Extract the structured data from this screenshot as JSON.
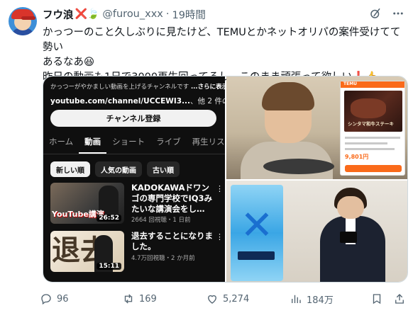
{
  "author": {
    "display_name": "フウ浪",
    "handle": "@furou_xxx",
    "separator": "·",
    "time": "19時間",
    "emoji": "❌🍃"
  },
  "tweet": {
    "line1": "かっつーのこと久しぶりに見たけど、TEMUとかネットオリパの案件受けてて勢い",
    "line2": "あるなあ😆",
    "line3": "昨日の動画も1日で3000再生回ってるし、このまま頑張って欲しい❗️👍"
  },
  "youtube": {
    "description": "かっつーがやかましい動画を上げるチャンネルです",
    "description_more": "...さらに表示",
    "link": "youtube.com/channel/UCCEWI3...",
    "link_more": "、他 2 件のリンク",
    "subscribe_label": "チャンネル登録",
    "tabs": [
      "ホーム",
      "動画",
      "ショート",
      "ライブ",
      "再生リス"
    ],
    "chips": [
      "新しい順",
      "人気の動画",
      "古い順"
    ],
    "videos": [
      {
        "title": "KADOKAWAドワンゴの専門学校でIQ3みたいな講演会をし…",
        "meta": "2664 回視聴・1 日前",
        "duration": "26:52",
        "banner": "YouTube講演"
      },
      {
        "title": "退去することになりました。",
        "meta": "4.7万回視聴・2 か月前",
        "duration": "15:11",
        "banner": "退去"
      }
    ]
  },
  "product_card": {
    "store": "TEMU",
    "title": "シンタマ和牛ステーキ",
    "price": "9,801円"
  },
  "actions": {
    "replies": "96",
    "retweets": "169",
    "likes": "5,274",
    "views": "184万"
  },
  "colors": {
    "text": "#0f1419",
    "muted": "#536471",
    "youtube_bg": "#0f0f0f",
    "temu_orange": "#fa6a1a"
  }
}
